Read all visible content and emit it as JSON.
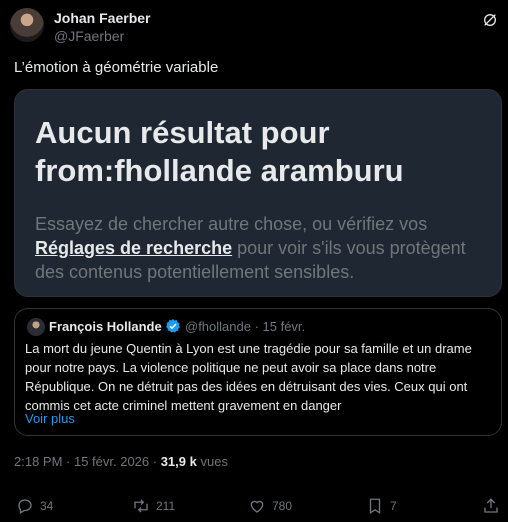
{
  "author": {
    "name": "Johan Faerber",
    "handle": "@JFaerber"
  },
  "tweet": {
    "text": "L’émotion à géométrie variable"
  },
  "card": {
    "title": "Aucun résultat pour from:fhollande aramburu",
    "body_before": "Essayez de chercher autre chose, ou vérifiez vos",
    "link": "Réglages de recherche",
    "body_after": "pour voir s'ils vous protègent des contenus potentiellement sensibles."
  },
  "quote": {
    "name": "François Hollande",
    "handle_date": "@fhollande · 15 févr.",
    "text": "La mort du jeune Quentin à Lyon est une tragédie pour sa famille et un drame pour notre pays. La violence politique ne peut avoir sa place dans notre République. On ne détruit pas des idées en détruisant des vies. Ceux qui ont commis cet acte criminel mettent gravement en danger",
    "more": "Voir plus"
  },
  "meta": {
    "time_date": "2:18 PM · 15 févr. 2026 ·",
    "views_count": "31,9 k",
    "views_label": "vues"
  },
  "actions": {
    "replies": "34",
    "reposts": "211",
    "likes": "780",
    "bookmarks": "7"
  },
  "colors": {
    "accent": "#1d9bf0",
    "muted": "#71767b",
    "card_bg": "#1e2732"
  },
  "icons": [
    "grok-icon",
    "verified-icon",
    "reply-icon",
    "repost-icon",
    "like-icon",
    "bookmark-icon",
    "share-icon"
  ]
}
